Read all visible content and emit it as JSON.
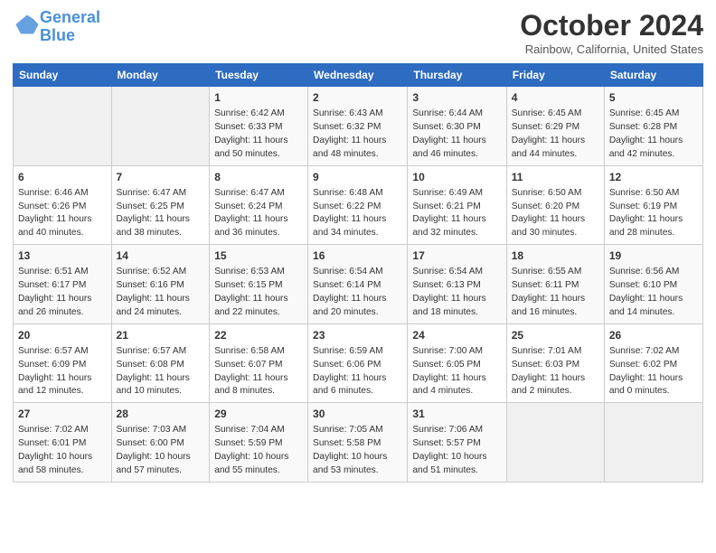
{
  "header": {
    "logo_line1": "General",
    "logo_line2": "Blue",
    "month_title": "October 2024",
    "location": "Rainbow, California, United States"
  },
  "days_of_week": [
    "Sunday",
    "Monday",
    "Tuesday",
    "Wednesday",
    "Thursday",
    "Friday",
    "Saturday"
  ],
  "weeks": [
    [
      {
        "day": "",
        "empty": true
      },
      {
        "day": "",
        "empty": true
      },
      {
        "day": "1",
        "sunrise": "Sunrise: 6:42 AM",
        "sunset": "Sunset: 6:33 PM",
        "daylight": "Daylight: 11 hours and 50 minutes."
      },
      {
        "day": "2",
        "sunrise": "Sunrise: 6:43 AM",
        "sunset": "Sunset: 6:32 PM",
        "daylight": "Daylight: 11 hours and 48 minutes."
      },
      {
        "day": "3",
        "sunrise": "Sunrise: 6:44 AM",
        "sunset": "Sunset: 6:30 PM",
        "daylight": "Daylight: 11 hours and 46 minutes."
      },
      {
        "day": "4",
        "sunrise": "Sunrise: 6:45 AM",
        "sunset": "Sunset: 6:29 PM",
        "daylight": "Daylight: 11 hours and 44 minutes."
      },
      {
        "day": "5",
        "sunrise": "Sunrise: 6:45 AM",
        "sunset": "Sunset: 6:28 PM",
        "daylight": "Daylight: 11 hours and 42 minutes."
      }
    ],
    [
      {
        "day": "6",
        "sunrise": "Sunrise: 6:46 AM",
        "sunset": "Sunset: 6:26 PM",
        "daylight": "Daylight: 11 hours and 40 minutes."
      },
      {
        "day": "7",
        "sunrise": "Sunrise: 6:47 AM",
        "sunset": "Sunset: 6:25 PM",
        "daylight": "Daylight: 11 hours and 38 minutes."
      },
      {
        "day": "8",
        "sunrise": "Sunrise: 6:47 AM",
        "sunset": "Sunset: 6:24 PM",
        "daylight": "Daylight: 11 hours and 36 minutes."
      },
      {
        "day": "9",
        "sunrise": "Sunrise: 6:48 AM",
        "sunset": "Sunset: 6:22 PM",
        "daylight": "Daylight: 11 hours and 34 minutes."
      },
      {
        "day": "10",
        "sunrise": "Sunrise: 6:49 AM",
        "sunset": "Sunset: 6:21 PM",
        "daylight": "Daylight: 11 hours and 32 minutes."
      },
      {
        "day": "11",
        "sunrise": "Sunrise: 6:50 AM",
        "sunset": "Sunset: 6:20 PM",
        "daylight": "Daylight: 11 hours and 30 minutes."
      },
      {
        "day": "12",
        "sunrise": "Sunrise: 6:50 AM",
        "sunset": "Sunset: 6:19 PM",
        "daylight": "Daylight: 11 hours and 28 minutes."
      }
    ],
    [
      {
        "day": "13",
        "sunrise": "Sunrise: 6:51 AM",
        "sunset": "Sunset: 6:17 PM",
        "daylight": "Daylight: 11 hours and 26 minutes."
      },
      {
        "day": "14",
        "sunrise": "Sunrise: 6:52 AM",
        "sunset": "Sunset: 6:16 PM",
        "daylight": "Daylight: 11 hours and 24 minutes."
      },
      {
        "day": "15",
        "sunrise": "Sunrise: 6:53 AM",
        "sunset": "Sunset: 6:15 PM",
        "daylight": "Daylight: 11 hours and 22 minutes."
      },
      {
        "day": "16",
        "sunrise": "Sunrise: 6:54 AM",
        "sunset": "Sunset: 6:14 PM",
        "daylight": "Daylight: 11 hours and 20 minutes."
      },
      {
        "day": "17",
        "sunrise": "Sunrise: 6:54 AM",
        "sunset": "Sunset: 6:13 PM",
        "daylight": "Daylight: 11 hours and 18 minutes."
      },
      {
        "day": "18",
        "sunrise": "Sunrise: 6:55 AM",
        "sunset": "Sunset: 6:11 PM",
        "daylight": "Daylight: 11 hours and 16 minutes."
      },
      {
        "day": "19",
        "sunrise": "Sunrise: 6:56 AM",
        "sunset": "Sunset: 6:10 PM",
        "daylight": "Daylight: 11 hours and 14 minutes."
      }
    ],
    [
      {
        "day": "20",
        "sunrise": "Sunrise: 6:57 AM",
        "sunset": "Sunset: 6:09 PM",
        "daylight": "Daylight: 11 hours and 12 minutes."
      },
      {
        "day": "21",
        "sunrise": "Sunrise: 6:57 AM",
        "sunset": "Sunset: 6:08 PM",
        "daylight": "Daylight: 11 hours and 10 minutes."
      },
      {
        "day": "22",
        "sunrise": "Sunrise: 6:58 AM",
        "sunset": "Sunset: 6:07 PM",
        "daylight": "Daylight: 11 hours and 8 minutes."
      },
      {
        "day": "23",
        "sunrise": "Sunrise: 6:59 AM",
        "sunset": "Sunset: 6:06 PM",
        "daylight": "Daylight: 11 hours and 6 minutes."
      },
      {
        "day": "24",
        "sunrise": "Sunrise: 7:00 AM",
        "sunset": "Sunset: 6:05 PM",
        "daylight": "Daylight: 11 hours and 4 minutes."
      },
      {
        "day": "25",
        "sunrise": "Sunrise: 7:01 AM",
        "sunset": "Sunset: 6:03 PM",
        "daylight": "Daylight: 11 hours and 2 minutes."
      },
      {
        "day": "26",
        "sunrise": "Sunrise: 7:02 AM",
        "sunset": "Sunset: 6:02 PM",
        "daylight": "Daylight: 11 hours and 0 minutes."
      }
    ],
    [
      {
        "day": "27",
        "sunrise": "Sunrise: 7:02 AM",
        "sunset": "Sunset: 6:01 PM",
        "daylight": "Daylight: 10 hours and 58 minutes."
      },
      {
        "day": "28",
        "sunrise": "Sunrise: 7:03 AM",
        "sunset": "Sunset: 6:00 PM",
        "daylight": "Daylight: 10 hours and 57 minutes."
      },
      {
        "day": "29",
        "sunrise": "Sunrise: 7:04 AM",
        "sunset": "Sunset: 5:59 PM",
        "daylight": "Daylight: 10 hours and 55 minutes."
      },
      {
        "day": "30",
        "sunrise": "Sunrise: 7:05 AM",
        "sunset": "Sunset: 5:58 PM",
        "daylight": "Daylight: 10 hours and 53 minutes."
      },
      {
        "day": "31",
        "sunrise": "Sunrise: 7:06 AM",
        "sunset": "Sunset: 5:57 PM",
        "daylight": "Daylight: 10 hours and 51 minutes."
      },
      {
        "day": "",
        "empty": true
      },
      {
        "day": "",
        "empty": true
      }
    ]
  ]
}
